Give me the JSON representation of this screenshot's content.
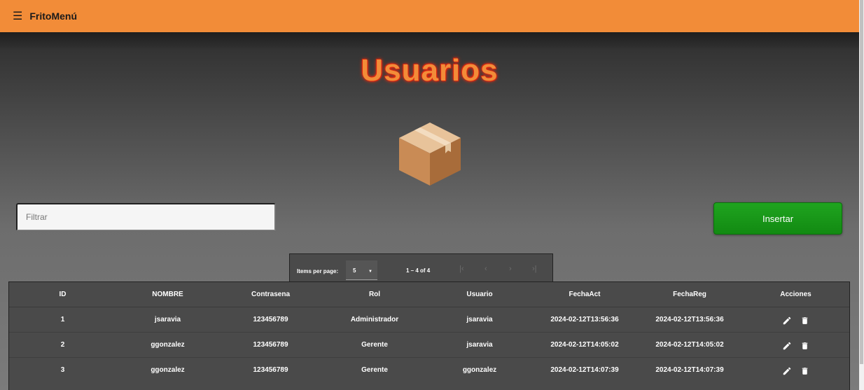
{
  "app": {
    "title": "FritoMenú"
  },
  "page": {
    "title": "Usuarios"
  },
  "filter": {
    "placeholder": "Filtrar",
    "value": ""
  },
  "insert_button": {
    "label": "Insertar"
  },
  "paginator": {
    "items_per_page_label": "Items per page:",
    "items_per_page_value": "5",
    "range_label": "1 – 4 of 4",
    "first_icon": "|‹",
    "prev_icon": "‹",
    "next_icon": "›",
    "last_icon": "›|"
  },
  "table": {
    "columns": [
      "ID",
      "NOMBRE",
      "Contrasena",
      "Rol",
      "Usuario",
      "FechaAct",
      "FechaReg",
      "Acciones"
    ],
    "rows": [
      [
        "1",
        "jsaravia",
        "123456789",
        "Administrador",
        "jsaravia",
        "2024-02-12T13:56:36",
        "2024-02-12T13:56:36"
      ],
      [
        "2",
        "ggonzalez",
        "123456789",
        "Gerente",
        "jsaravia",
        "2024-02-12T14:05:02",
        "2024-02-12T14:05:02"
      ],
      [
        "3",
        "ggonzalez",
        "123456789",
        "Gerente",
        "ggonzalez",
        "2024-02-12T14:07:39",
        "2024-02-12T14:07:39"
      ]
    ]
  },
  "colors": {
    "brand_orange": "#f28c38",
    "insert_green": "#1a9c1a",
    "table_bg": "#4a4a4a"
  },
  "icons": {
    "menu": "hamburger-icon",
    "hero": "package-box-icon",
    "edit": "pencil-icon",
    "delete": "trash-icon"
  }
}
